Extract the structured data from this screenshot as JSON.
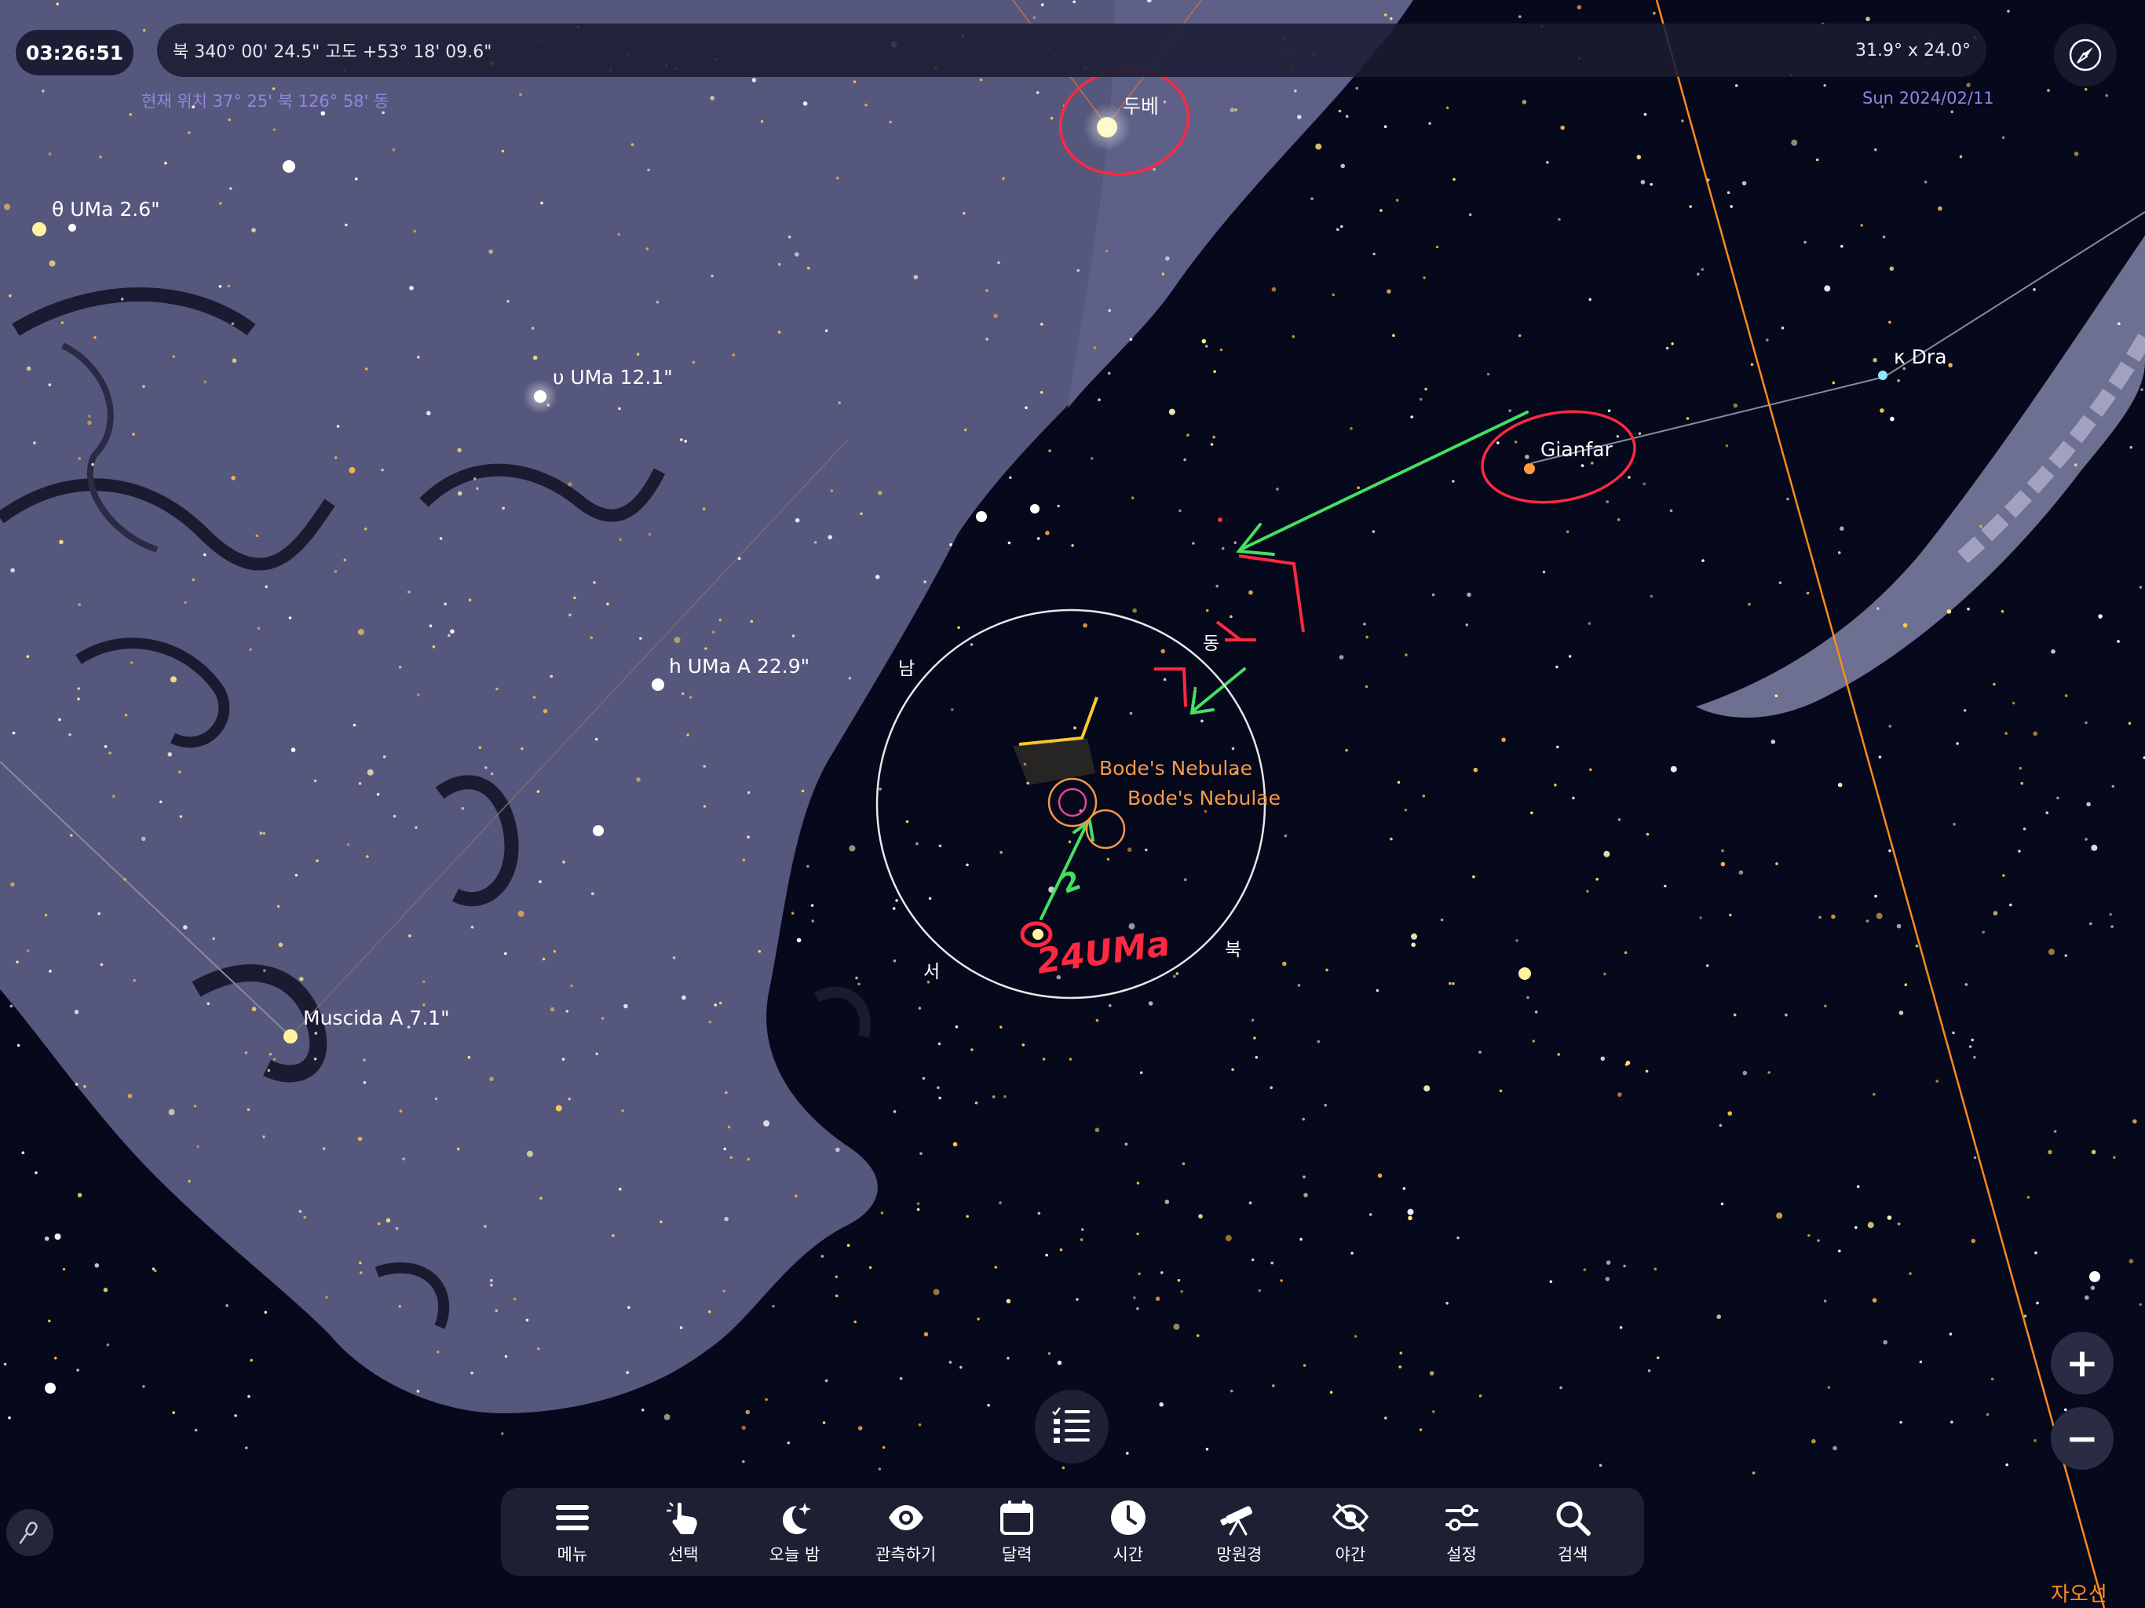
{
  "header": {
    "time": "03:26:51",
    "coordinates": "북 340° 00' 24.5\" 고도 +53° 18' 09.6\"",
    "field_of_view": "31.9° x 24.0°",
    "location": "현재 위치  37° 25' 북 126° 58' 동",
    "date": "Sun 2024/02/11"
  },
  "stars": {
    "dubhe": "두베",
    "theta_uma": "θ UMa  2.6\"",
    "upsilon_uma": "υ UMa  12.1\"",
    "h_uma": "h UMa A 22.9\"",
    "muscida": "Muscida A 7.1\"",
    "gianfar": "Gianfar",
    "kappa_dra": "κ Dra",
    "nebula_1": "Bode's Nebulae",
    "nebula_2": "Bode's Nebulae"
  },
  "finder_circle": {
    "east": "동",
    "south": "남",
    "west": "서",
    "north": "북"
  },
  "annotations": {
    "target_star": "24UMa",
    "step_mark": "2"
  },
  "meridian_label": "자오선",
  "zoom": {
    "in": "+",
    "out": "−"
  },
  "toolbar": {
    "items": [
      {
        "label": "메뉴",
        "icon": "menu-icon"
      },
      {
        "label": "선택",
        "icon": "select-hand-icon"
      },
      {
        "label": "오늘 밤",
        "icon": "moon-stars-icon"
      },
      {
        "label": "관측하기",
        "icon": "eye-icon"
      },
      {
        "label": "달력",
        "icon": "calendar-icon"
      },
      {
        "label": "시간",
        "icon": "clock-icon"
      },
      {
        "label": "망원경",
        "icon": "telescope-icon"
      },
      {
        "label": "야간",
        "icon": "night-mode-icon"
      },
      {
        "label": "설정",
        "icon": "sliders-icon"
      },
      {
        "label": "검색",
        "icon": "search-icon"
      }
    ]
  },
  "colors": {
    "sky": "#06081c",
    "constellation_art": "#5a5c82",
    "ui_accent": "#8f86e0",
    "nebula_label": "#f39a4a",
    "meridian": "#ff8a1c",
    "annotation_red": "#ff2840",
    "annotation_green": "#44e060",
    "annotation_yellow": "#ffc82a"
  }
}
